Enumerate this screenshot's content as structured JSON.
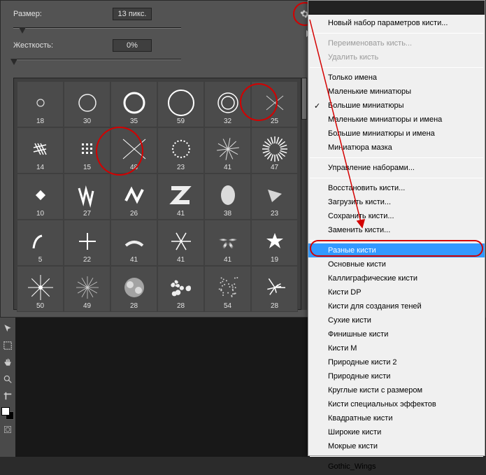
{
  "controls": {
    "size_label": "Размер:",
    "size_value": "13 пикс.",
    "hardness_label": "Жесткость:",
    "hardness_value": "0%"
  },
  "brushes": [
    {
      "size": "18",
      "shape": "small-circle-outline"
    },
    {
      "size": "30",
      "shape": "medium-ring"
    },
    {
      "size": "35",
      "shape": "thick-ring"
    },
    {
      "size": "59",
      "shape": "big-ring"
    },
    {
      "size": "32",
      "shape": "double-ring"
    },
    {
      "size": "25",
      "shape": "x-thin"
    },
    {
      "size": "14",
      "shape": "hash"
    },
    {
      "size": "15",
      "shape": "grid"
    },
    {
      "size": "48",
      "shape": "x-big"
    },
    {
      "size": "23",
      "shape": "dot-ring"
    },
    {
      "size": "41",
      "shape": "swirl"
    },
    {
      "size": "47",
      "shape": "sunburst"
    },
    {
      "size": "10",
      "shape": "diamond"
    },
    {
      "size": "27",
      "shape": "zigzag"
    },
    {
      "size": "26",
      "shape": "zigzag2"
    },
    {
      "size": "41",
      "shape": "z-bold"
    },
    {
      "size": "38",
      "shape": "blob"
    },
    {
      "size": "23",
      "shape": "tri"
    },
    {
      "size": "5",
      "shape": "curve"
    },
    {
      "size": "22",
      "shape": "cross"
    },
    {
      "size": "41",
      "shape": "dash"
    },
    {
      "size": "41",
      "shape": "snow"
    },
    {
      "size": "41",
      "shape": "star-soft"
    },
    {
      "size": "19",
      "shape": "star"
    },
    {
      "size": "50",
      "shape": "spark"
    },
    {
      "size": "49",
      "shape": "spark2"
    },
    {
      "size": "28",
      "shape": "cluster"
    },
    {
      "size": "28",
      "shape": "spots"
    },
    {
      "size": "54",
      "shape": "grain"
    },
    {
      "size": "28",
      "shape": "scatter"
    }
  ],
  "menu": {
    "items": [
      {
        "label": "Новый набор параметров кисти...",
        "enabled": true
      },
      {
        "sep": true
      },
      {
        "label": "Переименовать кисть...",
        "enabled": false
      },
      {
        "label": "Удалить кисть",
        "enabled": false
      },
      {
        "sep": true
      },
      {
        "label": "Только имена",
        "enabled": true
      },
      {
        "label": "Маленькие миниатюры",
        "enabled": true
      },
      {
        "label": "Большие миниатюры",
        "enabled": true,
        "checked": true
      },
      {
        "label": "Маленькие миниатюры и имена",
        "enabled": true
      },
      {
        "label": "Большие миниатюры и имена",
        "enabled": true
      },
      {
        "label": "Миниатюра мазка",
        "enabled": true
      },
      {
        "sep": true
      },
      {
        "label": "Управление наборами...",
        "enabled": true
      },
      {
        "sep": true
      },
      {
        "label": "Восстановить кисти...",
        "enabled": true
      },
      {
        "label": "Загрузить кисти...",
        "enabled": true
      },
      {
        "label": "Сохранить кисти...",
        "enabled": true
      },
      {
        "label": "Заменить кисти...",
        "enabled": true
      },
      {
        "sep": true
      },
      {
        "label": "Разные кисти",
        "enabled": true,
        "selected": true
      },
      {
        "label": "Основные кисти",
        "enabled": true
      },
      {
        "label": "Каллиграфические кисти",
        "enabled": true
      },
      {
        "label": "Кисти DP",
        "enabled": true
      },
      {
        "label": "Кисти для создания теней",
        "enabled": true
      },
      {
        "label": "Сухие кисти",
        "enabled": true
      },
      {
        "label": "Финишные кисти",
        "enabled": true
      },
      {
        "label": "Кисти M",
        "enabled": true
      },
      {
        "label": "Природные кисти 2",
        "enabled": true
      },
      {
        "label": "Природные кисти",
        "enabled": true
      },
      {
        "label": "Круглые кисти с размером",
        "enabled": true
      },
      {
        "label": "Кисти специальных эффектов",
        "enabled": true
      },
      {
        "label": "Квадратные кисти",
        "enabled": true
      },
      {
        "label": "Широкие кисти",
        "enabled": true
      },
      {
        "label": "Мокрые кисти",
        "enabled": true
      },
      {
        "sep": true
      },
      {
        "label": "Gothic_Wings",
        "enabled": true
      }
    ]
  }
}
